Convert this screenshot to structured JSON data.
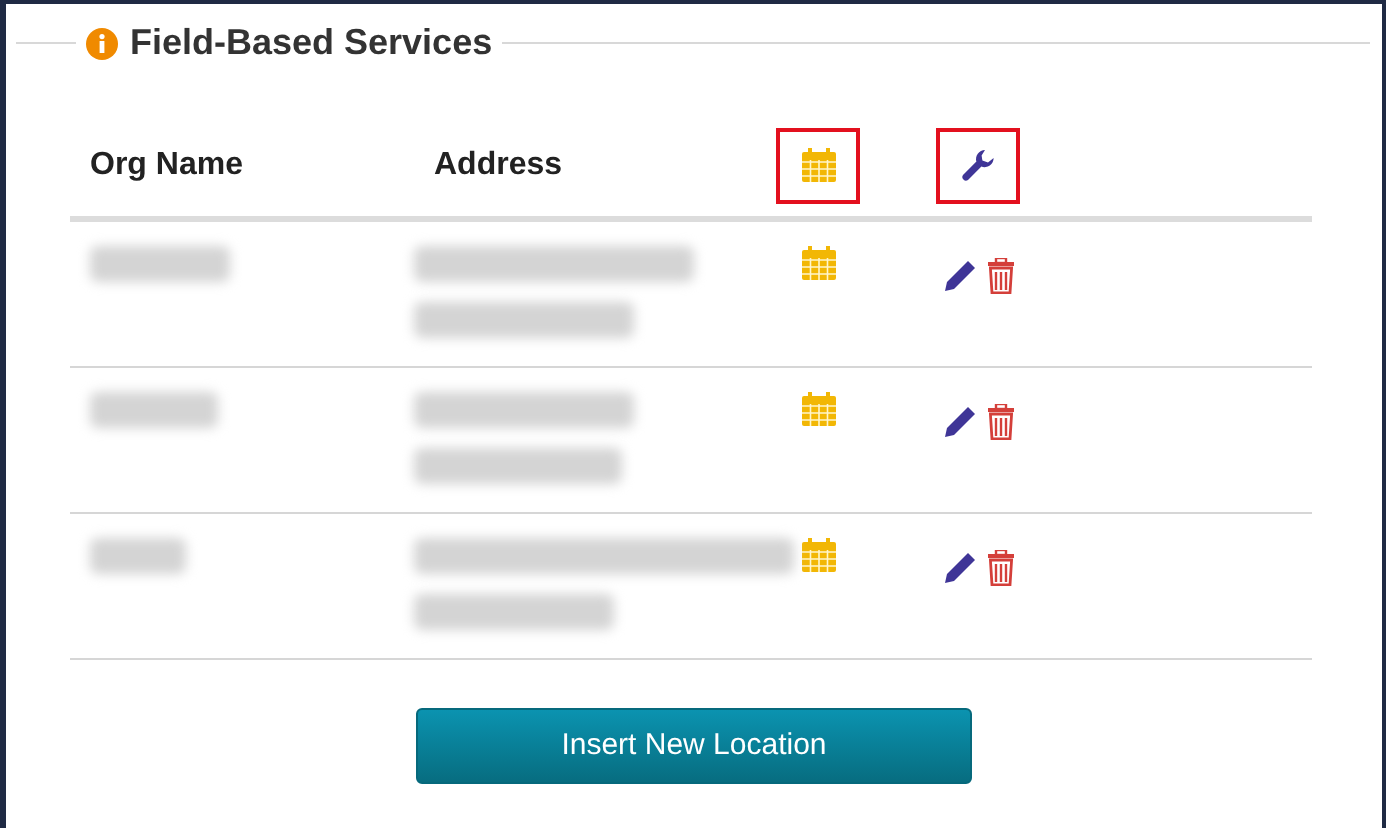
{
  "panel": {
    "title": "Field-Based Services"
  },
  "table": {
    "columns": [
      {
        "kind": "text",
        "label": "Org Name"
      },
      {
        "kind": "text",
        "label": "Address"
      },
      {
        "kind": "calendar",
        "highlighted": true
      },
      {
        "kind": "wrench",
        "highlighted": true
      }
    ],
    "rows": [
      {
        "org_name": {
          "kind": "blurred"
        },
        "address": [
          {
            "kind": "blurred"
          },
          {
            "kind": "blurred"
          }
        ]
      },
      {
        "org_name": {
          "kind": "blurred"
        },
        "address": [
          {
            "kind": "blurred"
          },
          {
            "kind": "blurred"
          }
        ]
      },
      {
        "org_name": {
          "kind": "blurred"
        },
        "address": [
          {
            "kind": "blurred"
          },
          {
            "kind": "blurred"
          }
        ]
      }
    ]
  },
  "buttons": [
    {
      "label": "Insert New Location"
    }
  ]
}
